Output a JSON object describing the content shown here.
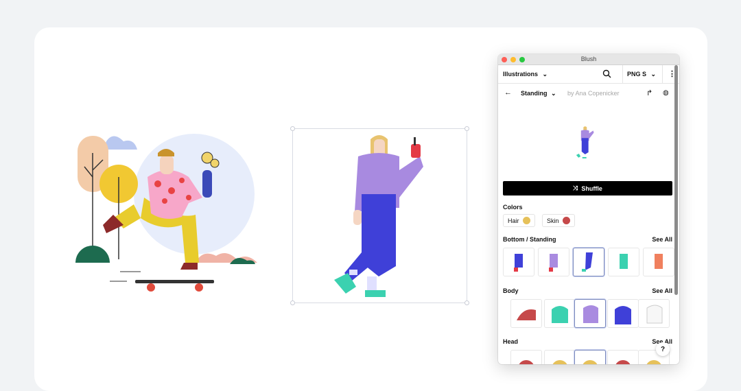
{
  "window": {
    "title": "Blush"
  },
  "toolbar": {
    "category": "Illustrations",
    "format": "PNG S"
  },
  "subheader": {
    "collection": "Standing",
    "author": "by Ana Copenicker"
  },
  "actions": {
    "shuffle": "Shuffle"
  },
  "colors": {
    "label": "Colors",
    "hair": {
      "label": "Hair",
      "color": "#e6c15a"
    },
    "skin": {
      "label": "Skin",
      "color": "#c6494a"
    }
  },
  "sections": {
    "bottom": {
      "label": "Bottom / Standing",
      "see_all": "See All"
    },
    "body": {
      "label": "Body",
      "see_all": "See All"
    },
    "head": {
      "label": "Head",
      "see_all": "See All"
    }
  },
  "help": {
    "label": "?"
  },
  "palette": {
    "purple": "#a98be0",
    "blue": "#3d3bd7",
    "yellow": "#f2cc2f",
    "pink": "#f6a5c9",
    "accent": "#000000"
  }
}
